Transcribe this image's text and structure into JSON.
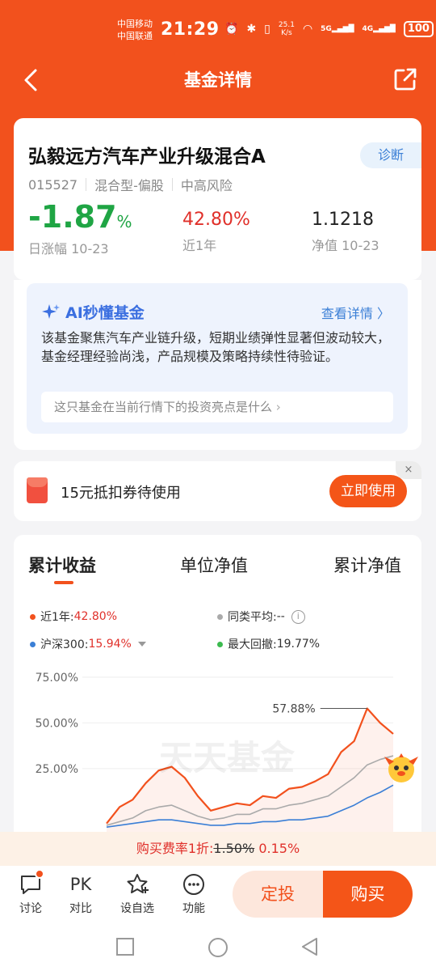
{
  "status_bar": {
    "carrier1": "中国移动",
    "carrier2": "中国联通",
    "time": "21:29",
    "net_speed_value": "25.1",
    "net_speed_unit": "K/s",
    "sig1_label": "5G",
    "sig2_label": "4G",
    "battery": "100"
  },
  "nav": {
    "title": "基金详情"
  },
  "fund": {
    "name": "弘毅远方汽车产业升级混合A",
    "diagnose": "诊断",
    "code": "015527",
    "type": "混合型-偏股",
    "risk": "中高风险",
    "daily_change_value": "-1.87",
    "daily_change_unit": "%",
    "daily_change_label": "日涨幅 10-23",
    "year_return": "42.80%",
    "year_return_label": "近1年",
    "nav_value": "1.1218",
    "nav_label": "净值 10-23"
  },
  "ai": {
    "title": "AI秒懂基金",
    "link": "查看详情",
    "description": "该基金聚焦汽车产业链升级，短期业绩弹性显著但波动较大，基金经理经验尚浅，产品规模及策略持续性待验证。",
    "question": "这只基金在当前行情下的投资亮点是什么"
  },
  "coupon": {
    "text": "15元抵扣券待使用",
    "button": "立即使用",
    "close": "×"
  },
  "chart": {
    "tabs": [
      "累计收益",
      "单位净值",
      "累计净值"
    ],
    "legend": {
      "fund_label": "近1年:",
      "fund_value": "42.80%",
      "peer_label": "同类平均:",
      "peer_value": "--",
      "index_label": "沪深300:",
      "index_value": "15.94%",
      "drawdown_label": "最大回撤:",
      "drawdown_value": "19.77%"
    },
    "watermark": "天天基金",
    "peak_label": "57.88%"
  },
  "chart_data": {
    "type": "line",
    "y_ticks": [
      "75.00%",
      "50.00%",
      "25.00%"
    ],
    "ylim": [
      -10,
      82
    ],
    "peak": 57.88,
    "series": [
      {
        "name": "近1年",
        "color": "#f2511d",
        "values": [
          -5,
          4,
          8,
          17,
          24,
          26,
          20,
          10,
          2,
          4,
          6,
          5,
          10,
          9,
          14,
          15,
          18,
          22,
          34,
          40,
          57.88,
          50,
          44
        ]
      },
      {
        "name": "同类平均",
        "color": "#aaaaaa",
        "values": [
          -6,
          -4,
          -2,
          2,
          4,
          5,
          2,
          -1,
          -3,
          -2,
          0,
          0,
          3,
          3,
          5,
          6,
          8,
          10,
          15,
          20,
          27,
          30,
          32
        ]
      },
      {
        "name": "沪深300",
        "color": "#3b7fd6",
        "values": [
          -7,
          -6,
          -5,
          -4,
          -3,
          -3,
          -4,
          -5,
          -6,
          -6,
          -5,
          -5,
          -4,
          -4,
          -3,
          -3,
          -2,
          -1,
          2,
          5,
          9,
          12,
          15.94
        ]
      }
    ]
  },
  "fee": {
    "prefix": "购买费率1折:",
    "original": "1.50%",
    "current": "0.15%"
  },
  "bottom": {
    "discuss": "讨论",
    "compare_icon": "PK",
    "compare": "对比",
    "watchlist": "设自选",
    "functions": "功能",
    "sip": "定投",
    "buy": "购买"
  },
  "icons": {
    "back": "chevron-left-icon",
    "share": "share-icon",
    "sparkle": "sparkle-icon",
    "coupon": "red-envelope-icon",
    "discuss": "chat-bubble-icon",
    "watchlist": "star-plus-icon",
    "functions": "more-icon"
  },
  "colors": {
    "brand": "#f2511d",
    "rise": "#e0302a",
    "fall": "#1fa544",
    "accent_blue": "#3b7fd6"
  }
}
